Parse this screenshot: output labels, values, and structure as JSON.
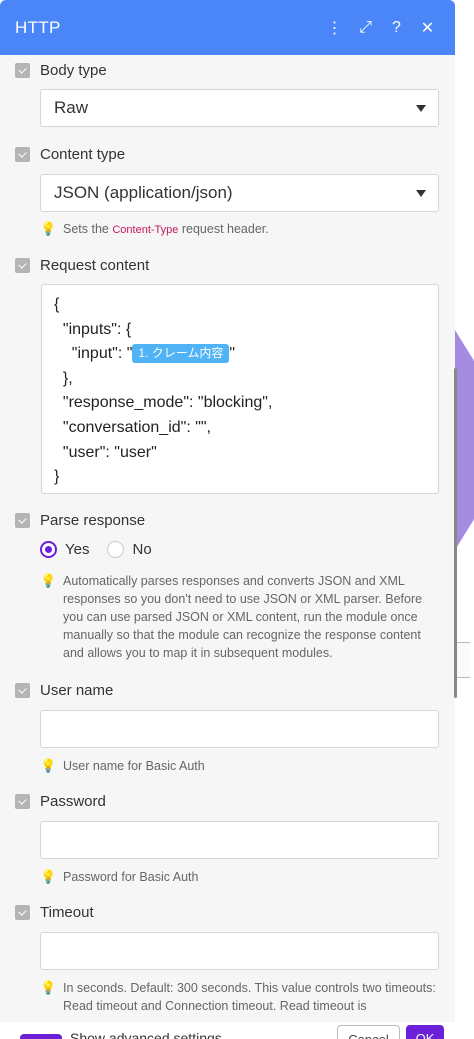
{
  "header": {
    "title": "HTTP",
    "icons": [
      "more-vertical-icon",
      "expand-icon",
      "help-icon",
      "close-icon"
    ],
    "btn_more": "⋮",
    "btn_expand": "⤢",
    "btn_help": "?",
    "btn_close": "✕"
  },
  "body_type": {
    "label": "Body type",
    "value": "Raw"
  },
  "content_type": {
    "label": "Content type",
    "value": "JSON (application/json)",
    "hint_prefix": "Sets the ",
    "hint_code": "Content-Type",
    "hint_suffix": " request header."
  },
  "request_content": {
    "label": "Request content",
    "lines": [
      "{",
      "  \"inputs\": {",
      "    \"input\": \"",
      "  },",
      "  \"response_mode\": \"blocking\",",
      "  \"conversation_id\": \"\",",
      "  \"user\": \"user\"",
      "}"
    ],
    "pill": "1. クレーム内容",
    "pill_after": "\""
  },
  "parse_response": {
    "label": "Parse response",
    "options": [
      "Yes",
      "No"
    ],
    "selected": "Yes",
    "hint": "Automatically parses responses and converts JSON and XML responses so you don't need to use JSON or XML parser. Before you can use parsed JSON or XML content, run the module once manually so that the module can recognize the response content and allows you to map it in subsequent modules."
  },
  "user_name": {
    "label": "User name",
    "value": "",
    "hint": "User name for Basic Auth"
  },
  "password": {
    "label": "Password",
    "value": "",
    "hint": "Password for Basic Auth"
  },
  "timeout": {
    "label": "Timeout",
    "value": "",
    "hint": "In seconds. Default: 300 seconds. This value controls two timeouts: Read timeout and Connection timeout. Read timeout is"
  },
  "footer": {
    "toggle_label": "Show advanced settings",
    "cancel": "Cancel",
    "ok": "OK"
  },
  "colors": {
    "header": "#4a86f7",
    "accent": "#6c1fd9",
    "pill": "#4fb3f5"
  }
}
